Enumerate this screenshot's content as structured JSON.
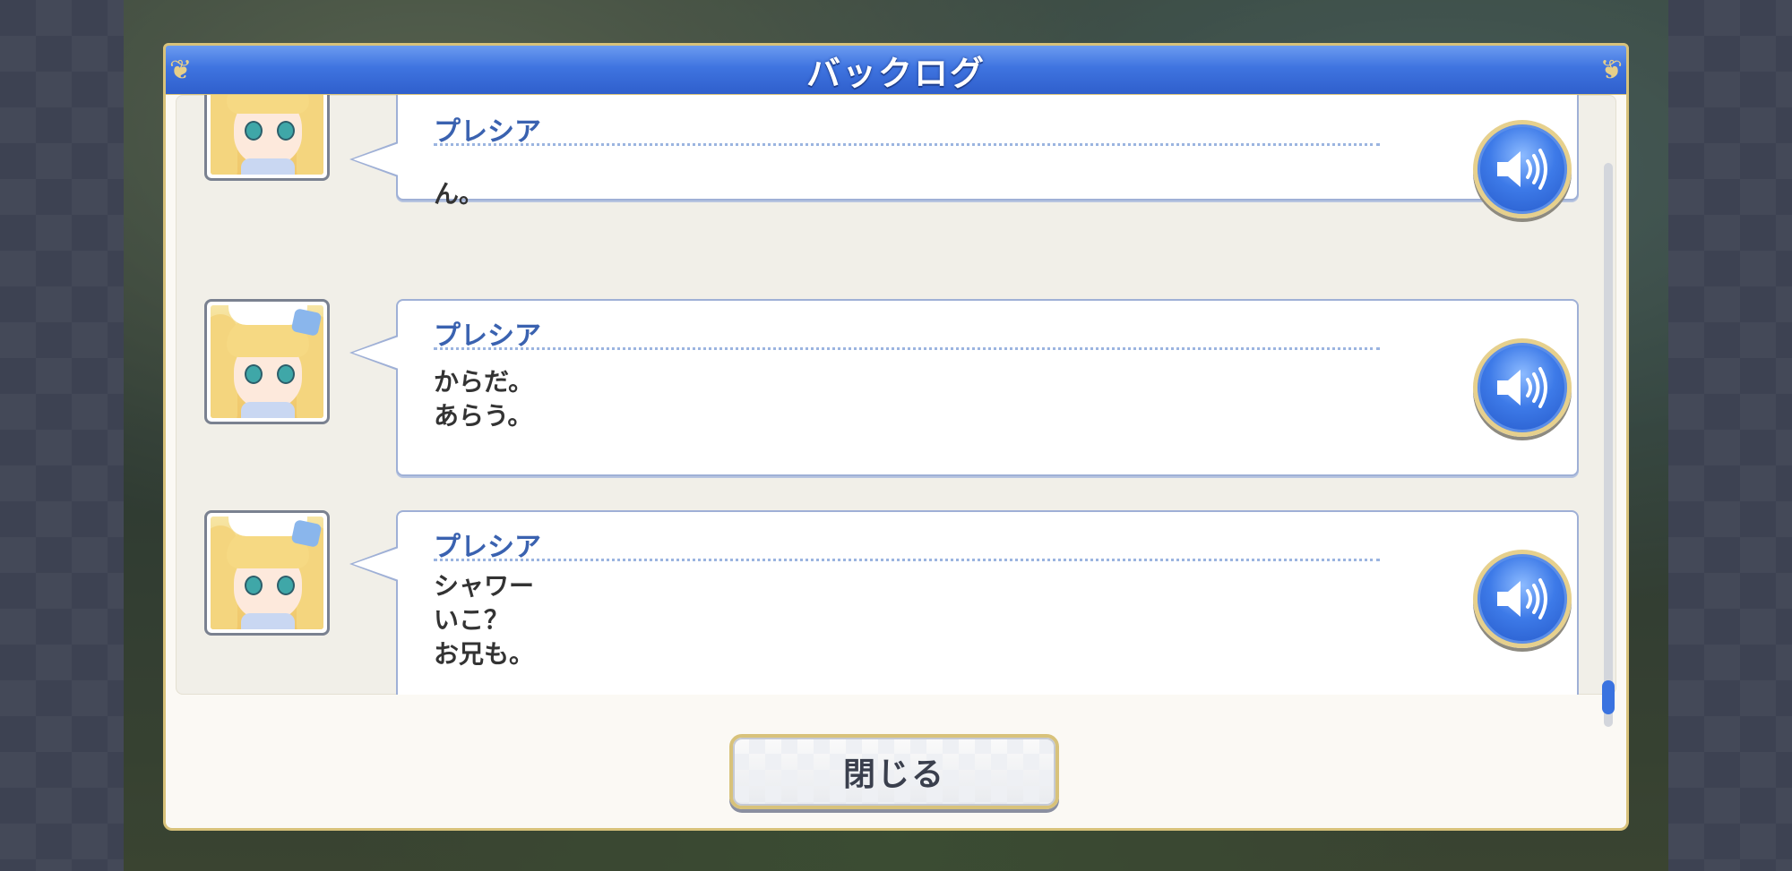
{
  "window": {
    "title": "バックログ"
  },
  "entries": [
    {
      "speaker": "プレシア",
      "message": "ん。"
    },
    {
      "speaker": "プレシア",
      "message": "からだ。\nあらう。"
    },
    {
      "speaker": "プレシア",
      "message": "シャワー\nいこ？\nお兄も。"
    }
  ],
  "icons": {
    "voice": "speaker-volume-icon",
    "avatar": "character-portrait"
  },
  "footer": {
    "close_label": "閉じる"
  },
  "colors": {
    "title_bar": "#3f74e0",
    "speaker_name": "#3a62b0",
    "border_gold": "#d8c27a",
    "scroll_thumb": "#3a73e0"
  }
}
